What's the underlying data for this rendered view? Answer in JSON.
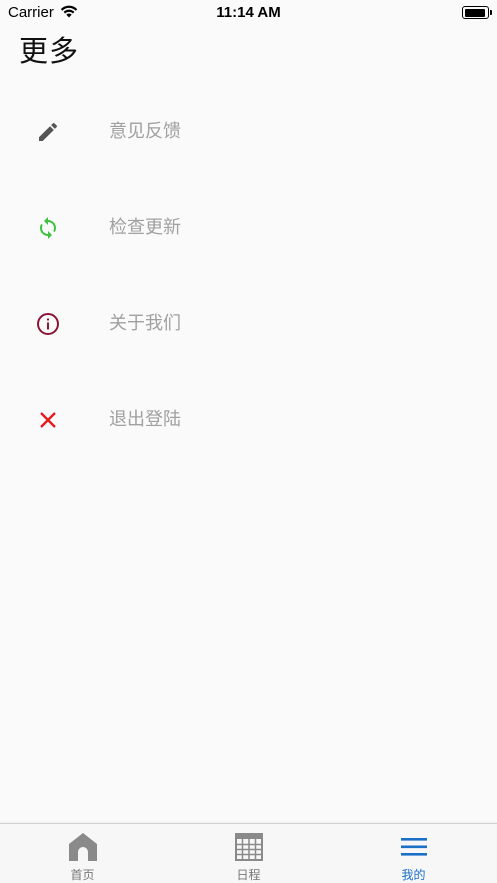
{
  "status_bar": {
    "carrier": "Carrier",
    "time": "11:14 AM"
  },
  "header": {
    "title": "更多"
  },
  "menu": {
    "items": [
      {
        "label": "意见反馈",
        "icon": "pencil-icon",
        "color": "#555555"
      },
      {
        "label": "检查更新",
        "icon": "refresh-icon",
        "color": "#3cc43c"
      },
      {
        "label": "关于我们",
        "icon": "info-icon",
        "color": "#8b1538"
      },
      {
        "label": "退出登陆",
        "icon": "close-icon",
        "color": "#e02020"
      }
    ]
  },
  "tab_bar": {
    "tabs": [
      {
        "label": "首页",
        "icon": "home-icon"
      },
      {
        "label": "日程",
        "icon": "calendar-icon"
      },
      {
        "label": "我的",
        "icon": "menu-icon",
        "active": true
      }
    ],
    "active_color": "#1a6fc7"
  }
}
